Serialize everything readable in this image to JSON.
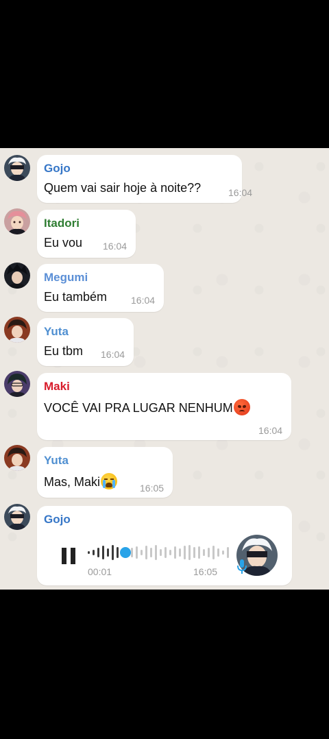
{
  "colors": {
    "gojo": "#3576c7",
    "itadori": "#2f7d32",
    "megumi": "#5b8fd6",
    "yuta": "#4f8fd1",
    "maki": "#d81b2a",
    "accent": "#29a3e8",
    "bubble": "#ffffff"
  },
  "messages": [
    {
      "sender": "Gojo",
      "text": "Quem vai sair hoje à noite??",
      "time": "16:04"
    },
    {
      "sender": "Itadori",
      "text": "Eu vou",
      "time": "16:04"
    },
    {
      "sender": "Megumi",
      "text": "Eu também",
      "time": "16:04"
    },
    {
      "sender": "Yuta",
      "text": "Eu tbm",
      "time": "16:04"
    },
    {
      "sender": "Maki",
      "text": "VOCÊ VAI PRA LUGAR NENHUM",
      "emoji": "angry-face",
      "time": "16:04"
    },
    {
      "sender": "Yuta",
      "text": "Mas, Maki",
      "emoji": "crying-face",
      "time": "16:05"
    }
  ],
  "voice": {
    "sender": "Gojo",
    "elapsed": "00:01",
    "time": "16:05",
    "progress": 0.22,
    "icons": [
      "pause-icon",
      "microphone-icon"
    ]
  }
}
